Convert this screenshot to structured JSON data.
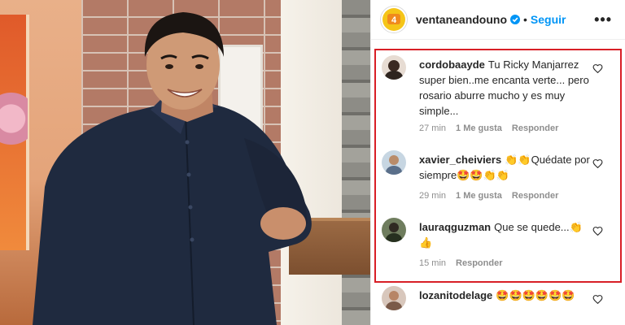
{
  "header": {
    "username": "ventaneandouno",
    "separator": "•",
    "follow_label": "Seguir",
    "more_label": "•••",
    "verified_color": "#0095f6"
  },
  "comments": [
    {
      "username": "cordobaayde",
      "text": "Tu Ricky Manjarrez super bien..me encanta verte... pero rosario aburre mucho y es muy simple...",
      "time": "27 min",
      "likes": "1 Me gusta",
      "reply": "Responder"
    },
    {
      "username": "xavier_cheiviers",
      "text": "👏👏Quédate por siempre🤩🤩👏👏",
      "time": "29 min",
      "likes": "1 Me gusta",
      "reply": "Responder"
    },
    {
      "username": "lauraqguzman",
      "text": "Que se quede...👏👍",
      "time": "15 min",
      "reply": "Responder"
    },
    {
      "username": "lozanitodelage",
      "text": "🤩🤩🤩🤩🤩🤩"
    }
  ],
  "colors": {
    "highlight_border": "#d81f26",
    "accent": "#0095f6",
    "muted": "#8e8e8e"
  },
  "icons": [
    "verified-badge-icon",
    "more-options-icon",
    "heart-icon"
  ]
}
